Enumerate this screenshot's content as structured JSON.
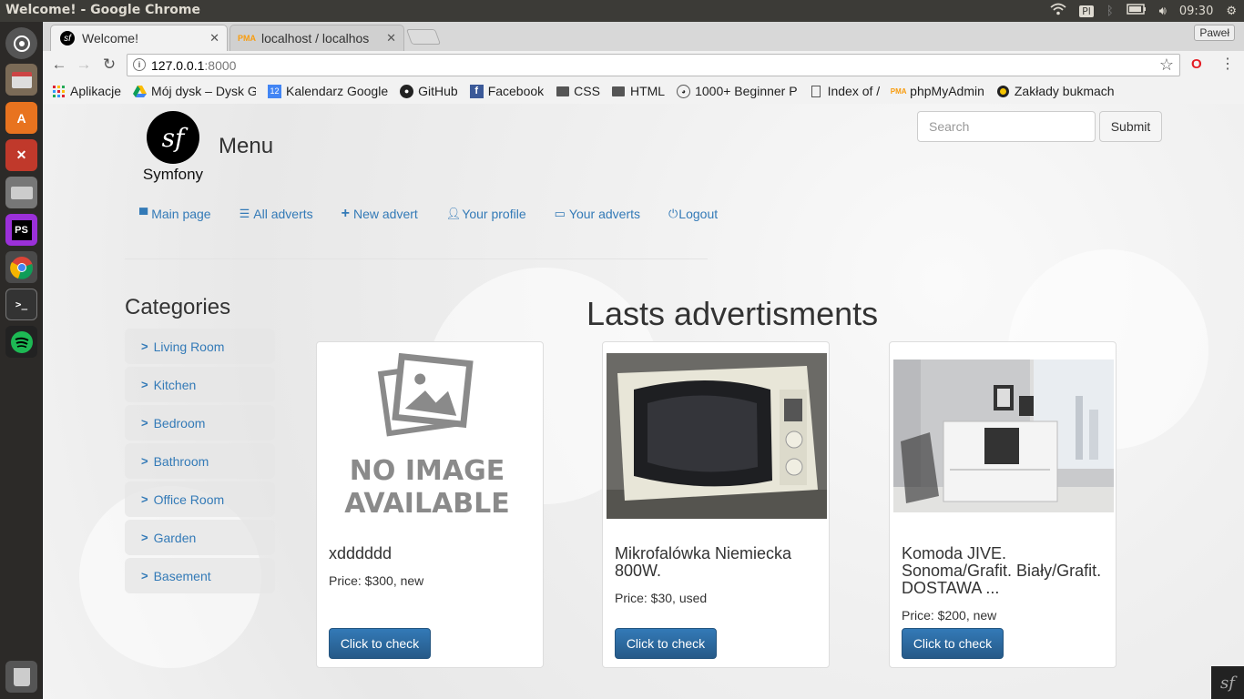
{
  "os": {
    "window_title": "Welcome! - Google Chrome",
    "keyboard_layout": "Pl",
    "clock": "09:30"
  },
  "browser": {
    "tabs": [
      {
        "title": "Welcome!",
        "icon": "symfony-icon",
        "active": true
      },
      {
        "title": "localhost / localhos",
        "icon": "phpmyadmin-icon",
        "active": false
      }
    ],
    "profile_name": "Paweł",
    "url_host": "127.0.0.1",
    "url_port": ":8000",
    "bookmarks": [
      {
        "label": "Aplikacje",
        "icon": "apps-grid-icon"
      },
      {
        "label": "Mój dysk – Dysk G",
        "icon": "google-drive-icon"
      },
      {
        "label": "Kalendarz Google",
        "icon": "calendar-icon"
      },
      {
        "label": "GitHub",
        "icon": "github-icon"
      },
      {
        "label": "Facebook",
        "icon": "facebook-icon"
      },
      {
        "label": "CSS",
        "icon": "folder-icon"
      },
      {
        "label": "HTML",
        "icon": "folder-icon"
      },
      {
        "label": "1000+ Beginner P",
        "icon": "reddit-icon"
      },
      {
        "label": "Index of /",
        "icon": "page-icon"
      },
      {
        "label": "phpMyAdmin",
        "icon": "phpmyadmin-icon"
      },
      {
        "label": "Zakłady bukmach",
        "icon": "circle-icon"
      }
    ]
  },
  "site": {
    "logo_text": "Symfony",
    "menu_title": "Menu",
    "search_placeholder": "Search",
    "submit_label": "Submit",
    "nav": [
      {
        "label": "Main page",
        "icon": "chair-icon"
      },
      {
        "label": "All adverts",
        "icon": "list-icon"
      },
      {
        "label": "New advert",
        "icon": "plus-icon"
      },
      {
        "label": "Your profile",
        "icon": "user-icon"
      },
      {
        "label": "Your adverts",
        "icon": "inbox-icon"
      },
      {
        "label": "Logout",
        "icon": "power-icon"
      }
    ],
    "categories_title": "Categories",
    "categories": [
      "Living Room",
      "Kitchen",
      "Bedroom",
      "Bathroom",
      "Office Room",
      "Garden",
      "Basement"
    ],
    "adverts_title": "Lasts advertisments",
    "no_image_line1": "NO IMAGE",
    "no_image_line2": "AVAILABLE",
    "adverts": [
      {
        "title": "xdddddd",
        "price": "Price: $300, new",
        "button": "Click to check",
        "image": "no-image"
      },
      {
        "title": "Mikrofalówka Niemiecka 800W.",
        "price": "Price: $30, used",
        "button": "Click to check",
        "image": "microwave-photo"
      },
      {
        "title": "Komoda JIVE. Sonoma/Grafit. Biały/Grafit. DOSTAWA ...",
        "price": "Price: $200, new",
        "button": "Click to check",
        "image": "dresser-photo"
      }
    ]
  }
}
